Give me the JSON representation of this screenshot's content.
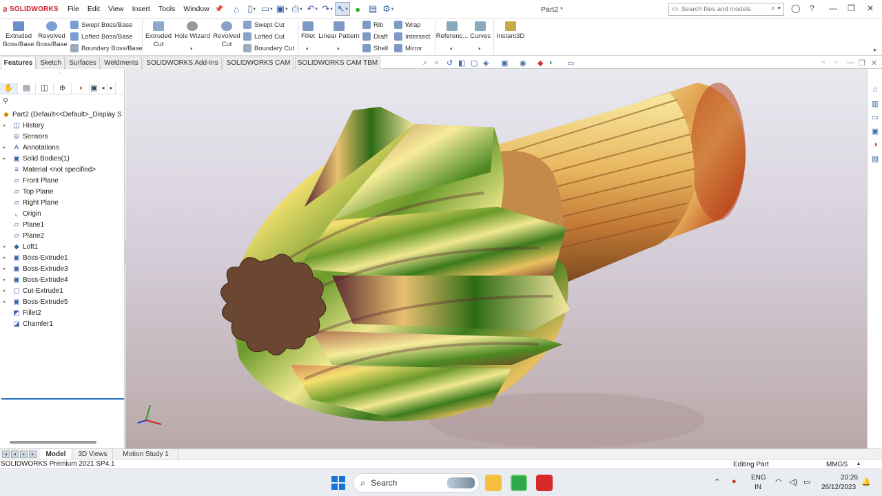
{
  "app": {
    "brand": "SOLIDWORKS",
    "doc_title": "Part2 *",
    "menu": [
      "File",
      "Edit",
      "View",
      "Insert",
      "Tools",
      "Window"
    ],
    "search_placeholder": "Search files and models"
  },
  "ribbon": {
    "extruded_boss": "Extruded\nBoss/Base",
    "revolved_boss": "Revolved\nBoss/Base",
    "swept_boss": "Swept Boss/Base",
    "lofted_boss": "Lofted Boss/Base",
    "boundary_boss": "Boundary Boss/Base",
    "extruded_cut": "Extruded\nCut",
    "hole_wizard": "Hole Wizard",
    "revolved_cut": "Revolved\nCut",
    "swept_cut": "Swept Cut",
    "lofted_cut": "Lofted Cut",
    "boundary_cut": "Boundary Cut",
    "fillet": "Fillet",
    "linear_pattern": "Linear Pattern",
    "rib": "Rib",
    "draft": "Draft",
    "shell": "Shell",
    "wrap": "Wrap",
    "intersect": "Intersect",
    "mirror": "Mirror",
    "reference": "Referenc...",
    "curves": "Curves",
    "instant3d": "Instant3D"
  },
  "command_tabs": [
    "Features",
    "Sketch",
    "Surfaces",
    "Weldments",
    "SOLIDWORKS Add-Ins",
    "SOLIDWORKS CAM",
    "SOLIDWORKS CAM TBM"
  ],
  "tree": {
    "root": "Part2  (Default<<Default>_Display S",
    "items": [
      {
        "label": "History",
        "exp": true
      },
      {
        "label": "Sensors",
        "exp": false
      },
      {
        "label": "Annotations",
        "exp": true
      },
      {
        "label": "Solid Bodies(1)",
        "exp": true
      },
      {
        "label": "Material <not specified>",
        "exp": false
      },
      {
        "label": "Front Plane",
        "exp": false
      },
      {
        "label": "Top Plane",
        "exp": false
      },
      {
        "label": "Right Plane",
        "exp": false
      },
      {
        "label": "Origin",
        "exp": false
      },
      {
        "label": "Plane1",
        "exp": false
      },
      {
        "label": "Plane2",
        "exp": false
      },
      {
        "label": "Loft1",
        "exp": true
      },
      {
        "label": "Boss-Extrude1",
        "exp": true
      },
      {
        "label": "Boss-Extrude3",
        "exp": true
      },
      {
        "label": "Boss-Extrude4",
        "exp": true
      },
      {
        "label": "Cut-Extrude1",
        "exp": true
      },
      {
        "label": "Boss-Extrude5",
        "exp": true
      },
      {
        "label": "Fillet2",
        "exp": false
      },
      {
        "label": "Chamfer1",
        "exp": false
      }
    ]
  },
  "bottom_tabs": [
    "Model",
    "3D Views",
    "Motion Study 1"
  ],
  "status": {
    "left": "SOLIDWORKS Premium 2021 SP4.1",
    "mode": "Editing Part",
    "units": "MMGS"
  },
  "taskbar": {
    "search": "Search",
    "lang1": "ENG",
    "lang2": "IN",
    "time": "20:26",
    "date": "26/12/2023"
  }
}
